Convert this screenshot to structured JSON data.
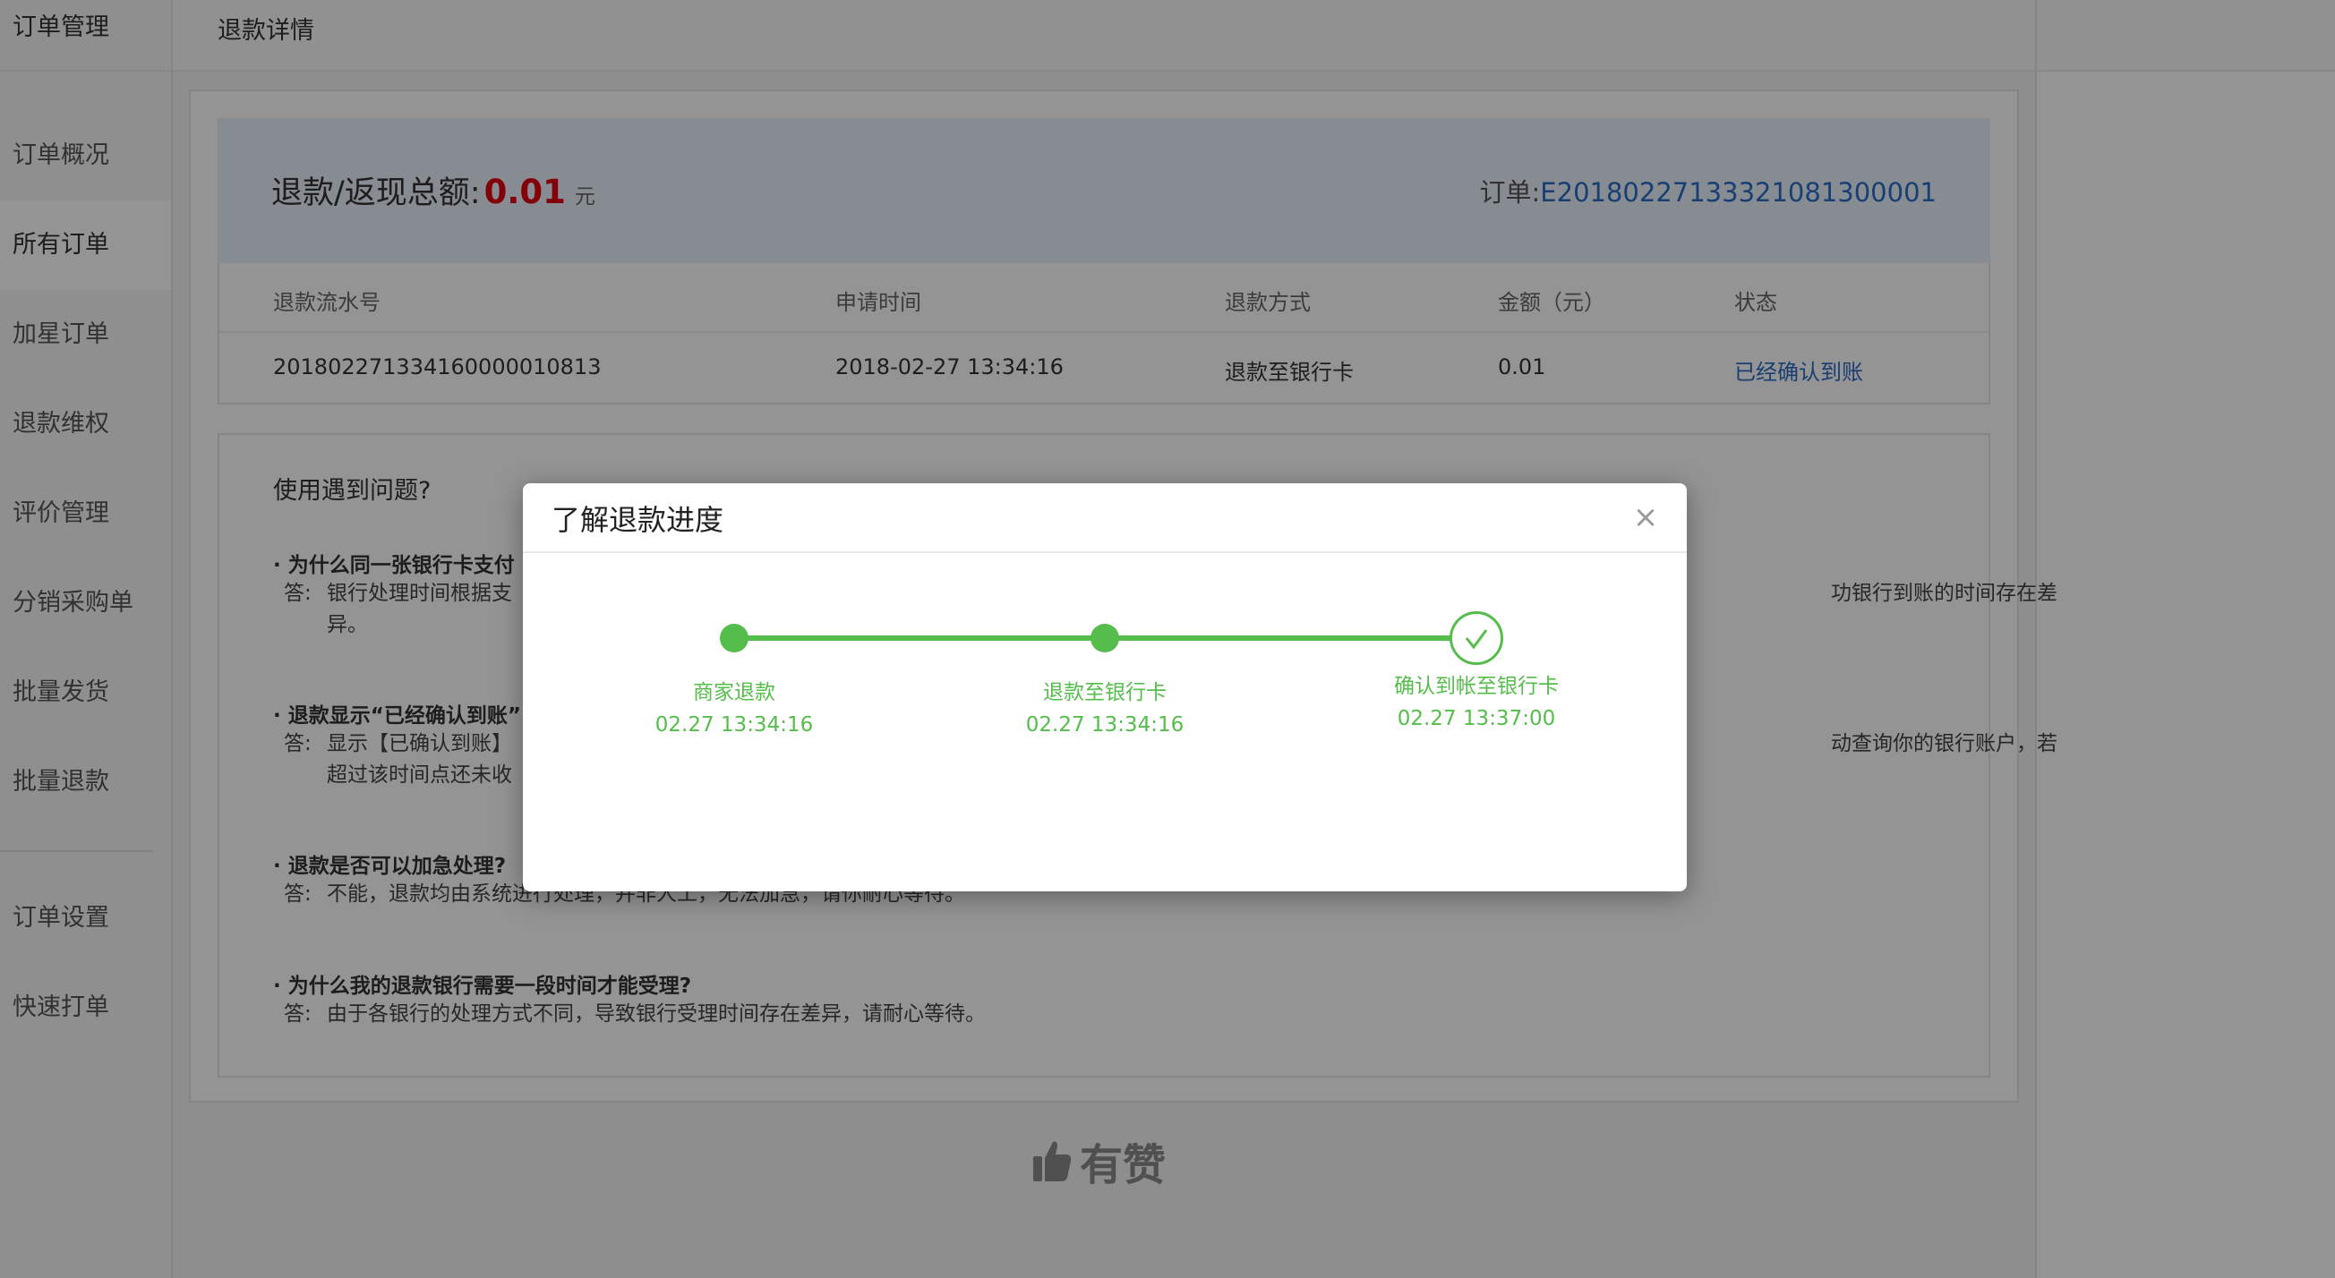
{
  "sidebar": {
    "header": "订单管理",
    "items": [
      {
        "label": "订单概况"
      },
      {
        "label": "所有订单"
      },
      {
        "label": "加星订单"
      },
      {
        "label": "退款维权"
      },
      {
        "label": "评价管理"
      },
      {
        "label": "分销采购单"
      },
      {
        "label": "批量发货"
      },
      {
        "label": "批量退款"
      }
    ],
    "bottom_items": [
      {
        "label": "订单设置"
      },
      {
        "label": "快速打单"
      }
    ]
  },
  "topbar": {
    "title": "退款详情"
  },
  "summary": {
    "label": "退款/返现总额:",
    "amount": "0.01",
    "unit": "元",
    "order_label": "订单:",
    "order_no": "E20180227133321081300001"
  },
  "refund_table": {
    "headers": [
      "退款流水号",
      "申请时间",
      "退款方式",
      "金额（元）",
      "状态"
    ],
    "row": {
      "serial": "201802271334160000010813",
      "time": "2018-02-27 13:34:16",
      "method": "退款至银行卡",
      "amount": "0.01",
      "status": "已经确认到账"
    }
  },
  "faq": {
    "title": "使用遇到问题?",
    "items": [
      {
        "q": "· 为什么同一张银行卡支付",
        "a_label": "答:",
        "a": "银行处理时间根据支",
        "a_tail": "功银行到账的时间存在差",
        "a_line2": "异。"
      },
      {
        "q": "· 退款显示“已经确认到账”",
        "a_label": "答:",
        "a": "显示【已确认到账】",
        "a_tail": "动查询你的银行账户，若",
        "a_line2": "超过该时间点还未收"
      },
      {
        "q": "· 退款是否可以加急处理?",
        "a_label": "答:",
        "a": "不能，退款均由系统进行处理，并非人工，无法加急，请你耐心等待。"
      },
      {
        "q": "· 为什么我的退款银行需要一段时间才能受理?",
        "a_label": "答:",
        "a": "由于各银行的处理方式不同，导致银行受理时间存在差异，请耐心等待。"
      }
    ]
  },
  "brand": {
    "text": "有赞",
    "icon": "thumbs-up-icon"
  },
  "modal": {
    "title": "了解退款进度",
    "close": "×",
    "steps": [
      {
        "name": "商家退款",
        "time": "02.27 13:34:16"
      },
      {
        "name": "退款至银行卡",
        "time": "02.27 13:34:16"
      },
      {
        "name": "确认到帐至银行卡",
        "time": "02.27 13:37:00"
      }
    ]
  },
  "colors": {
    "accent_green": "#55bd4b",
    "amount_red": "#e4000f",
    "link_blue": "#2b6cc4",
    "summary_bg": "#e9f1fb"
  }
}
